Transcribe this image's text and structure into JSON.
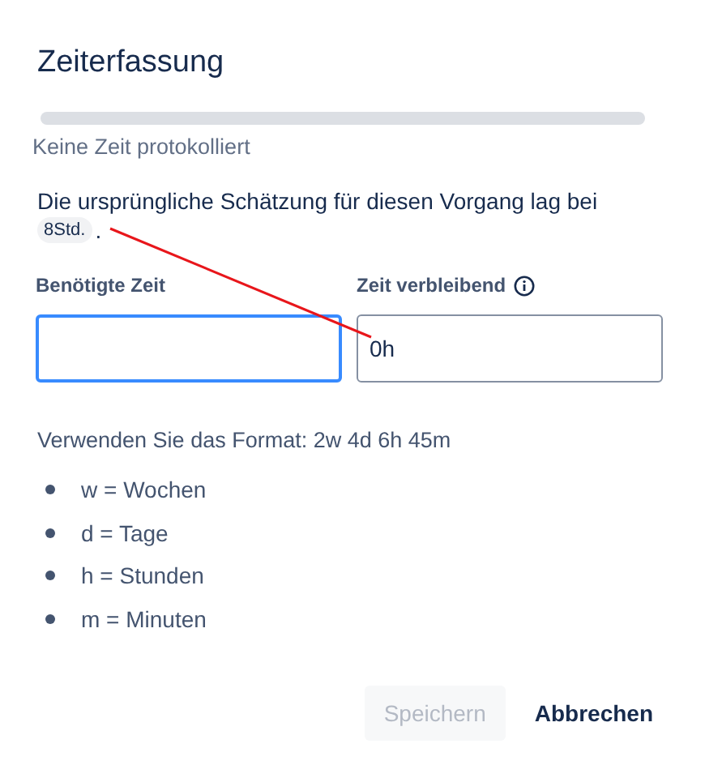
{
  "dialog": {
    "title": "Zeiterfassung"
  },
  "progress": {
    "level": 0,
    "caption": "Keine Zeit protokolliert"
  },
  "estimate": {
    "text": "Die ursprüngliche Schätzung für diesen Vorgang lag bei",
    "badge": "8Std.",
    "suffix": "."
  },
  "fields": [
    {
      "label": "Benötigte Zeit",
      "focused": true,
      "info": false
    },
    {
      "label": "Zeit verbleibend",
      "value": "0h",
      "focused": false,
      "info": true
    }
  ],
  "format_hint": "Verwenden Sie das Format: 2w 4d 6h 45m",
  "units": [
    "w = Wochen",
    "d = Tage",
    "h = Stunden",
    "m = Minuten"
  ],
  "buttons": [
    {
      "label": "Speichern",
      "disabled": true
    },
    {
      "label": "Abbrechen",
      "disabled": false
    }
  ]
}
